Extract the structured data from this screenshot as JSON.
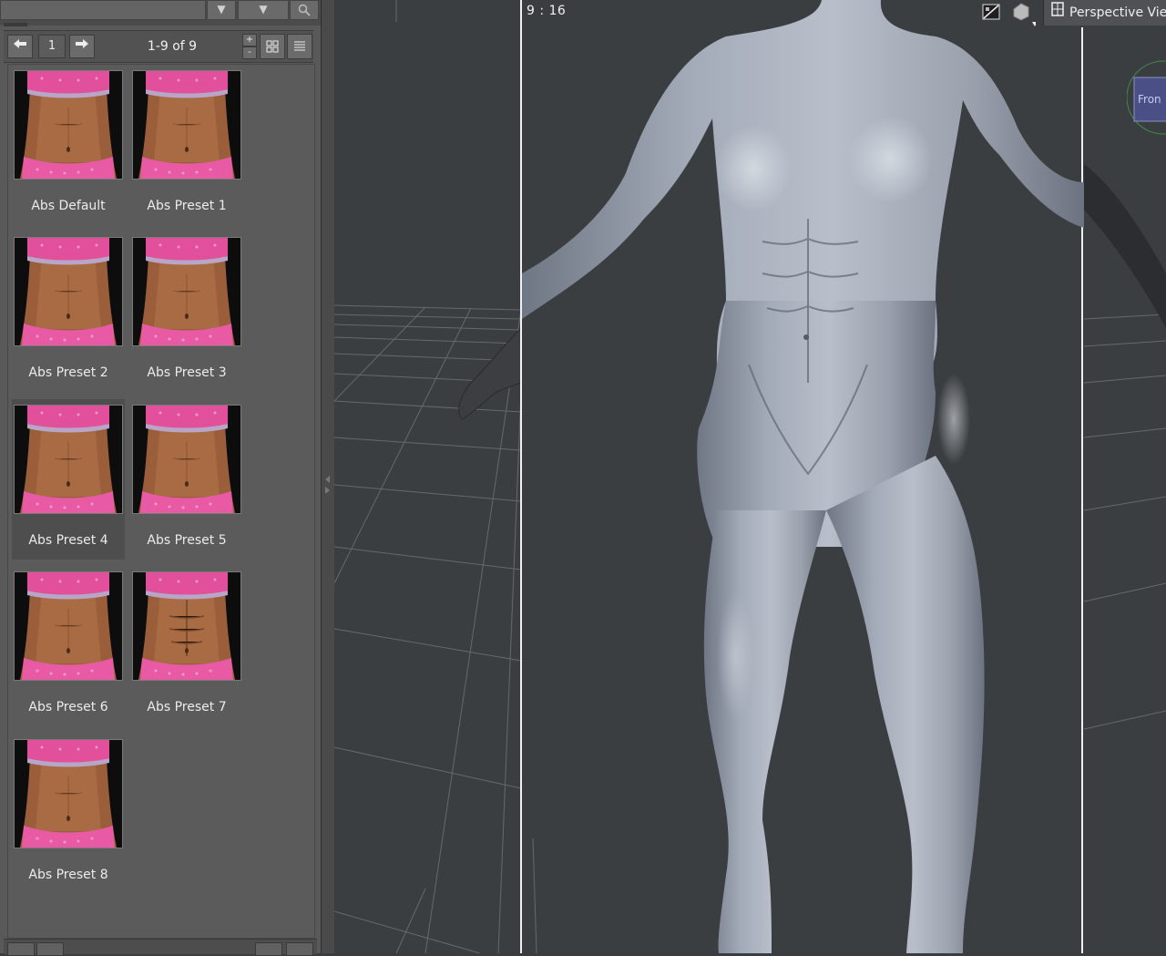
{
  "top": {
    "dropdown_arrow": "▼",
    "search_icon": "search-icon"
  },
  "nav": {
    "prev_icon": "arrow-left-icon",
    "next_icon": "arrow-right-icon",
    "page": "1",
    "range": "1-9 of 9",
    "zoom_in": "+",
    "zoom_out": "-",
    "grid_view_icon": "grid-view-icon",
    "list_view_icon": "list-view-icon"
  },
  "presets": [
    {
      "label": "Abs Default"
    },
    {
      "label": "Abs Preset 1"
    },
    {
      "label": "Abs Preset 2"
    },
    {
      "label": "Abs Preset 3"
    },
    {
      "label": "Abs Preset 4",
      "selected": true
    },
    {
      "label": "Abs Preset 5"
    },
    {
      "label": "Abs Preset 6"
    },
    {
      "label": "Abs Preset 7",
      "defined_abs": true
    },
    {
      "label": "Abs Preset 8"
    }
  ],
  "viewport": {
    "aspect_ratio": "9 : 16",
    "camera_label": "Perspective View",
    "colors": {
      "background": "#3b3e41",
      "figure": "#9aa2b0",
      "grid": "#8a8d90"
    }
  }
}
